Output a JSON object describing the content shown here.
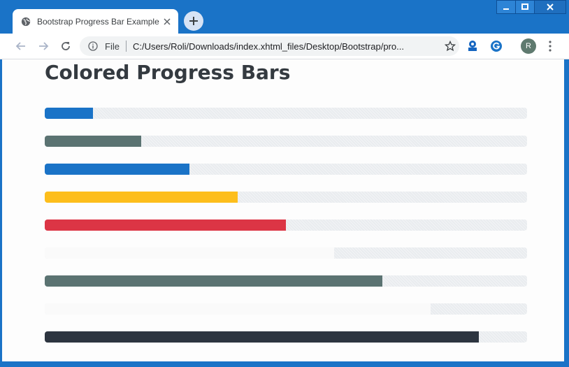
{
  "browser": {
    "tab_title": "Bootstrap Progress Bar Example",
    "address_prefix": "File",
    "url": "C:/Users/Roli/Downloads/index.xhtml_files/Desktop/Bootstrap/pro...",
    "profile_initial": "R"
  },
  "page": {
    "title": "Colored Progress Bars"
  },
  "progress_bars": [
    {
      "value": 10,
      "color": "#1a73c7"
    },
    {
      "value": 20,
      "color": "#5b7372"
    },
    {
      "value": 30,
      "color": "#1a73c7"
    },
    {
      "value": 40,
      "color": "#fdbe1c"
    },
    {
      "value": 50,
      "color": "#dc3545"
    },
    {
      "value": 60,
      "color": "#fafafa"
    },
    {
      "value": 70,
      "color": "#5b7372"
    },
    {
      "value": 80,
      "color": "#fafafa"
    },
    {
      "value": 90,
      "color": "#2d3540"
    }
  ],
  "colors": {
    "titlebar": "#1a73c7",
    "track": "#e9ecef"
  }
}
